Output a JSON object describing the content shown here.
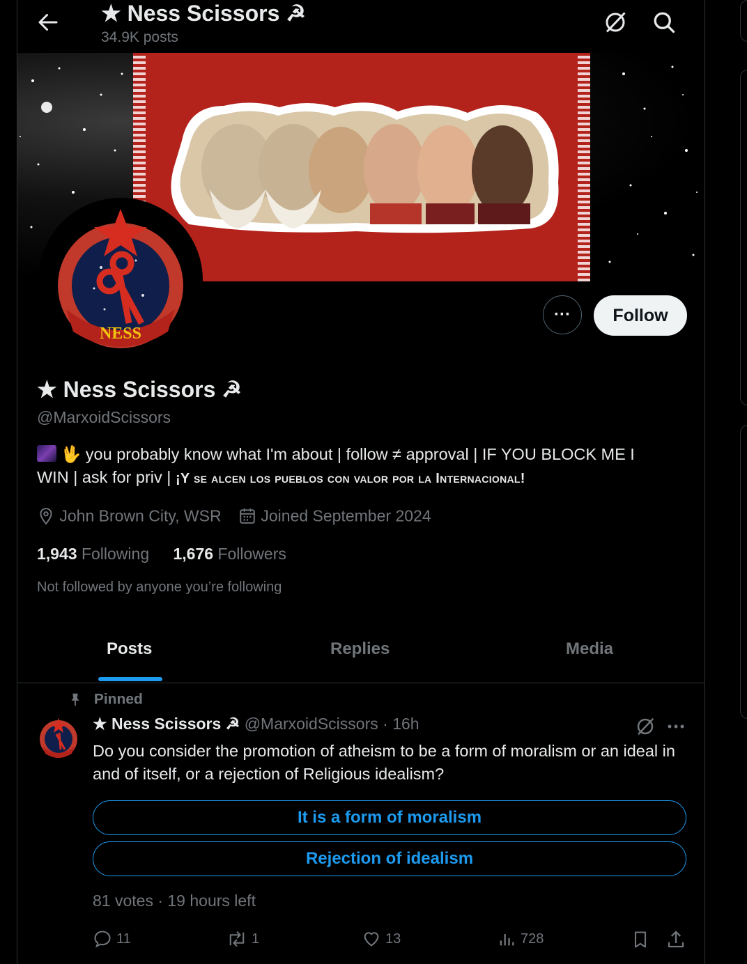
{
  "header": {
    "title": "★ Ness Scissors ☭",
    "posts_count": "34.9K posts"
  },
  "profile": {
    "name": "★ Ness Scissors ☭",
    "handle": "@MarxoidScissors",
    "avatar_text": "NESS",
    "bio_line1": "you probably know what I'm about | follow ≠ approval | IF YOU BLOCK ME I",
    "bio_line2_a": "WIN | ask for priv | ",
    "bio_line2_b": "¡Y se alcen los pueblos con valor por la Internacional!",
    "location": "John Brown City, WSR",
    "joined": "Joined September 2024",
    "following_count": "1,943",
    "following_label": "Following",
    "followers_count": "1,676",
    "followers_label": "Followers",
    "not_followed": "Not followed by anyone you’re following"
  },
  "buttons": {
    "more": "···",
    "follow": "Follow"
  },
  "tabs": [
    {
      "label": "Posts",
      "active": true
    },
    {
      "label": "Replies",
      "active": false
    },
    {
      "label": "Media",
      "active": false
    }
  ],
  "post": {
    "pinned_label": "Pinned",
    "author_name": "★ Ness Scissors ☭",
    "author_handle": "@MarxoidScissors",
    "time": "· 16h",
    "text": "Do you consider the promotion of atheism to be a form of moralism or an ideal in and of itself, or a rejection of Religious idealism?",
    "poll": {
      "options": [
        "It is a form of moralism",
        "Rejection of idealism"
      ],
      "meta": "81 votes · 19 hours left"
    },
    "actions": {
      "replies": "11",
      "reposts": "1",
      "likes": "13",
      "views": "728"
    }
  },
  "colors": {
    "accent": "#1d9bf0",
    "muted": "#71767b",
    "border": "#2f3336",
    "banner_red": "#b3231c"
  }
}
